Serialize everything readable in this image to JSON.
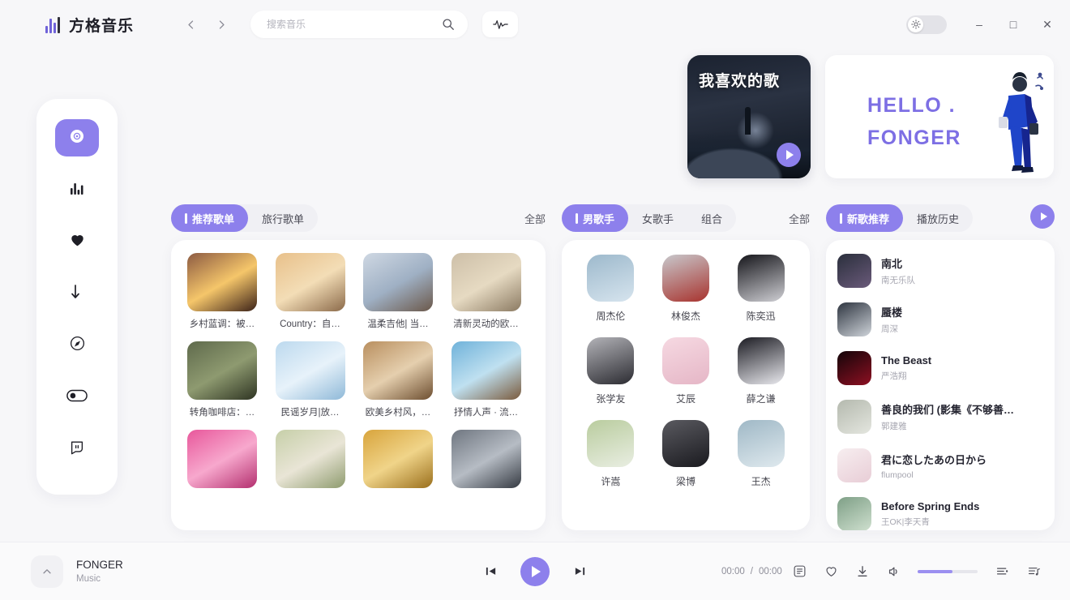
{
  "app": {
    "brand_name": "方格音乐",
    "logo_icon": "equalizer-logo-icon"
  },
  "topbar": {
    "back_icon": "chevron-left-icon",
    "forward_icon": "chevron-right-icon",
    "search": {
      "value": "",
      "placeholder": "搜索音乐",
      "icon": "search-icon"
    },
    "eq_button_icon": "audio-wave-icon",
    "theme_toggle_icon": "sun-icon",
    "minimize_label": "–",
    "maximize_label": "□",
    "close_label": "✕"
  },
  "sidebar": {
    "items": [
      {
        "icon": "disc-home-icon",
        "name": "discover",
        "active": true
      },
      {
        "icon": "bar-chart-icon",
        "name": "ranking",
        "active": false
      },
      {
        "icon": "heart-icon",
        "name": "favorites",
        "active": false
      },
      {
        "icon": "download-arrow-icon",
        "name": "downloads",
        "active": false
      },
      {
        "icon": "compass-icon",
        "name": "explore",
        "active": false
      },
      {
        "icon": "toggle-switch-icon",
        "name": "settings",
        "active": false
      },
      {
        "icon": "shield-message-icon",
        "name": "about",
        "active": false
      }
    ]
  },
  "hero": {
    "favorite_card": {
      "title": "我喜欢的歌",
      "play_icon": "play-icon"
    },
    "banner": {
      "line1": "HELLO .",
      "line2": "FONGER",
      "illustration": "walking-person-illustration"
    }
  },
  "playlists": {
    "tabs": [
      {
        "label": "推荐歌单",
        "active": true
      },
      {
        "label": "旅行歌单",
        "active": false
      }
    ],
    "all_label": "全部",
    "items": [
      {
        "title": "乡村蓝调：被…",
        "c1": "#8c5a42",
        "c2": "#f5c66a",
        "c3": "#3c2218"
      },
      {
        "title": "Country：自…",
        "c1": "#e8c08a",
        "c2": "#f3ddb6",
        "c3": "#8b6a4a"
      },
      {
        "title": "温柔吉他| 当…",
        "c1": "#cfd8e3",
        "c2": "#9fb0c4",
        "c3": "#6b584a"
      },
      {
        "title": "清新灵动的欧…",
        "c1": "#cdbfa8",
        "c2": "#e6dac2",
        "c3": "#8b7a62"
      },
      {
        "title": "转角咖啡店：…",
        "c1": "#5f6a4c",
        "c2": "#8e9a70",
        "c3": "#2e3422"
      },
      {
        "title": "民谣岁月|放…",
        "c1": "#bcd9ee",
        "c2": "#e7f2fa",
        "c3": "#8fb9d8"
      },
      {
        "title": "欧美乡村风，…",
        "c1": "#b98f5f",
        "c2": "#e5cfae",
        "c3": "#6d4e30"
      },
      {
        "title": "抒情人声 · 流…",
        "c1": "#6fb2da",
        "c2": "#bfe0f0",
        "c3": "#7a5a3c"
      },
      {
        "title": "",
        "c1": "#e8579b",
        "c2": "#f7a8cd",
        "c3": "#b32f6e"
      },
      {
        "title": "",
        "c1": "#c6cfa8",
        "c2": "#e9e5d6",
        "c3": "#8e9b6e"
      },
      {
        "title": "",
        "c1": "#d8a43c",
        "c2": "#f0d489",
        "c3": "#9a6f1c"
      },
      {
        "title": "",
        "c1": "#6f7680",
        "c2": "#b6bcc4",
        "c3": "#353a42"
      }
    ]
  },
  "artists": {
    "tabs": [
      {
        "label": "男歌手",
        "active": true
      },
      {
        "label": "女歌手",
        "active": false
      },
      {
        "label": "组合",
        "active": false
      }
    ],
    "all_label": "全部",
    "items": [
      {
        "name": "周杰伦",
        "c1": "#9db9cc",
        "c2": "#d6e4ee"
      },
      {
        "name": "林俊杰",
        "c1": "#c8c8cc",
        "c2": "#a8332e"
      },
      {
        "name": "陈奕迅",
        "c1": "#15151a",
        "c2": "#cfcfd4"
      },
      {
        "name": "张学友",
        "c1": "#b3b3b8",
        "c2": "#2c2c32"
      },
      {
        "name": "艾辰",
        "c1": "#f6d9e2",
        "c2": "#e5b6c6"
      },
      {
        "name": "薛之谦",
        "c1": "#1b1b22",
        "c2": "#e9e9ee"
      },
      {
        "name": "许嵩",
        "c1": "#b9cc9e",
        "c2": "#e9eee2"
      },
      {
        "name": "梁博",
        "c1": "#5a5a60",
        "c2": "#1a1a1f"
      },
      {
        "name": "王杰",
        "c1": "#9fb8c6",
        "c2": "#dfe9ee"
      }
    ]
  },
  "newsongs": {
    "tabs": [
      {
        "label": "新歌推荐",
        "active": true
      },
      {
        "label": "播放历史",
        "active": false
      }
    ],
    "play_icon": "play-icon",
    "items": [
      {
        "title": "南北",
        "artist": "南无乐队",
        "c1": "#2a2f3c",
        "c2": "#6a5a7a"
      },
      {
        "title": "蜃楼",
        "artist": "周深",
        "c1": "#2e3540",
        "c2": "#cfd4da"
      },
      {
        "title": "The Beast",
        "artist": "严浩翔",
        "c1": "#130509",
        "c2": "#8e1022"
      },
      {
        "title": "善良的我们 (影集《不够善…",
        "artist": "郭建雅",
        "c1": "#b4b9ae",
        "c2": "#e4e6df"
      },
      {
        "title": "君に恋したあの日から",
        "artist": "flumpool",
        "c1": "#f7eef0",
        "c2": "#e8cdd6"
      },
      {
        "title": "Before Spring Ends",
        "artist": "王OK|李天青",
        "c1": "#7e9f86",
        "c2": "#cfe0cf"
      }
    ]
  },
  "player": {
    "expand_icon": "chevron-up-icon",
    "song": "FONGER",
    "subtitle": "Music",
    "prev_icon": "previous-track-icon",
    "play_icon": "play-icon",
    "next_icon": "next-track-icon",
    "current_time": "00:00",
    "time_separator": "/",
    "total_time": "00:00",
    "lyrics_icon": "lyrics-icon",
    "favorite_icon": "heart-outline-icon",
    "download_icon": "download-icon",
    "volume_icon": "speaker-icon",
    "volume_percent": 58,
    "playlist_icon": "playlist-icon",
    "queue_icon": "queue-music-icon"
  },
  "colors": {
    "accent": "#8d80ec",
    "accent_soft": "#9b8ff0",
    "background": "#f7f7f9",
    "panel": "#ffffff"
  }
}
